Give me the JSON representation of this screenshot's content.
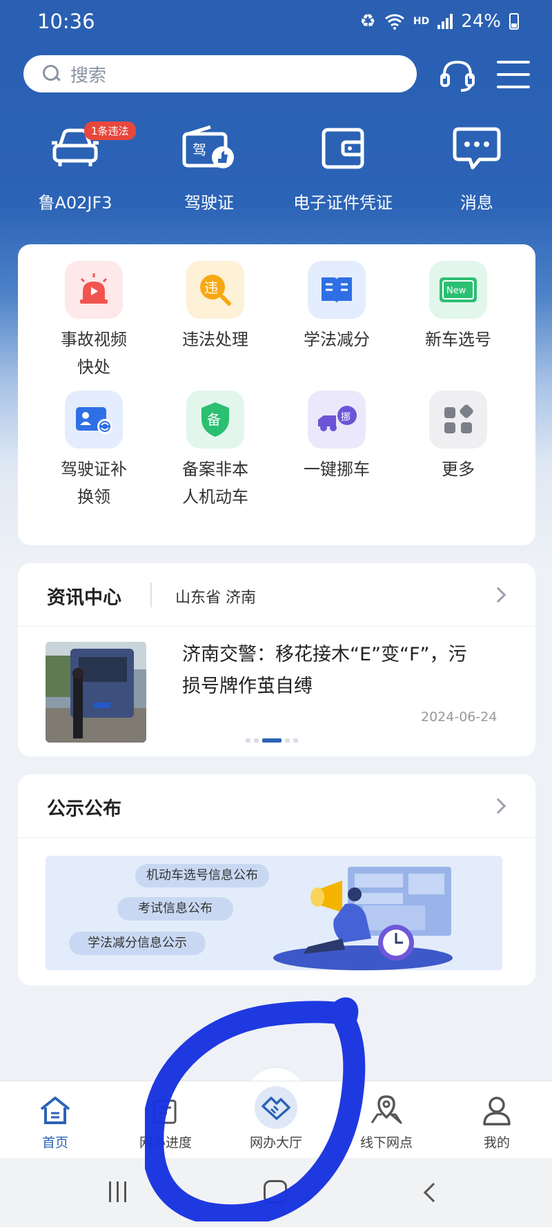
{
  "status_bar": {
    "time": "10:36",
    "network": "HD",
    "battery": "24%"
  },
  "search": {
    "placeholder": "搜索"
  },
  "quick_cards": [
    {
      "label": "鲁A02JF3",
      "icon": "car-icon",
      "badge": "1条违法"
    },
    {
      "label": "驾驶证",
      "icon": "license-icon"
    },
    {
      "label": "电子证件凭证",
      "icon": "wallet-icon"
    },
    {
      "label": "消息",
      "icon": "message-icon"
    }
  ],
  "services": [
    {
      "line1": "事故视频",
      "line2": "快处",
      "icon": "siren-icon",
      "tile_color": "#fde8ea"
    },
    {
      "line1": "违法处理",
      "line2": "",
      "icon": "violation-icon",
      "tile_color": "#fdf1d8"
    },
    {
      "line1": "学法减分",
      "line2": "",
      "icon": "book-icon",
      "tile_color": "#e4edfd"
    },
    {
      "line1": "新车选号",
      "line2": "",
      "icon": "new-plate-icon",
      "tile_color": "#e2f6ec"
    },
    {
      "line1": "驾驶证补",
      "line2": "换领",
      "icon": "license-renew-icon",
      "tile_color": "#e4edfd"
    },
    {
      "line1": "备案非本",
      "line2": "人机动车",
      "icon": "shield-icon",
      "tile_color": "#e2f6ec"
    },
    {
      "line1": "一键挪车",
      "line2": "",
      "icon": "tow-truck-icon",
      "tile_color": "#ece8fb"
    },
    {
      "line1": "更多",
      "line2": "",
      "icon": "more-grid-icon",
      "tile_color": "#efeff1"
    }
  ],
  "news": {
    "title": "资讯中心",
    "location": "山东省 济南",
    "headline_line1": "济南交警：移花接木“E”变“F”，污",
    "headline_line2": "损号牌作茧自缚",
    "date": "2024-06-24"
  },
  "notice": {
    "title": "公示公布",
    "banner_items": [
      "机动车选号信息公布",
      "考试信息公布",
      "学法减分信息公示"
    ]
  },
  "bottom_nav": [
    {
      "label": "首页",
      "icon": "home-icon",
      "active": true
    },
    {
      "label": "网办进度",
      "icon": "progress-icon",
      "active": false
    },
    {
      "label": "网办大厅",
      "icon": "handshake-icon",
      "active": false
    },
    {
      "label": "线下网点",
      "icon": "map-pin-icon",
      "active": false
    },
    {
      "label": "我的",
      "icon": "user-icon",
      "active": false
    }
  ],
  "colors": {
    "brand_blue": "#2b63b6",
    "badge_red": "#e8473b",
    "annotation_blue": "#1833e0"
  }
}
